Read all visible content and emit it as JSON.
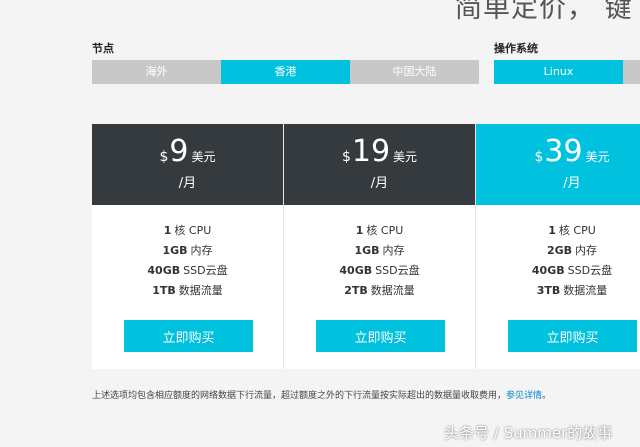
{
  "headline": "简单定价，   键",
  "node_section": {
    "label": "节点",
    "options": [
      "海外",
      "香港",
      "中国大陆"
    ],
    "selected": "香港"
  },
  "os_section": {
    "label": "操作系统",
    "options": [
      "Linux"
    ],
    "selected": "Linux"
  },
  "plans": [
    {
      "currency": "$",
      "amount": "9",
      "unit": "美元",
      "period": "/月",
      "specs": [
        {
          "value": "1",
          "label": "核 CPU"
        },
        {
          "value": "1GB",
          "label": "内存"
        },
        {
          "value": "40GB",
          "label": "SSD云盘"
        },
        {
          "value": "1TB",
          "label": "数据流量"
        }
      ],
      "buy_label": "立即购买"
    },
    {
      "currency": "$",
      "amount": "19",
      "unit": "美元",
      "period": "/月",
      "specs": [
        {
          "value": "1",
          "label": "核 CPU"
        },
        {
          "value": "1GB",
          "label": "内存"
        },
        {
          "value": "40GB",
          "label": "SSD云盘"
        },
        {
          "value": "2TB",
          "label": "数据流量"
        }
      ],
      "buy_label": "立即购买"
    },
    {
      "currency": "$",
      "amount": "39",
      "unit": "美元",
      "period": "/月",
      "specs": [
        {
          "value": "1",
          "label": "核 CPU"
        },
        {
          "value": "2GB",
          "label": "内存"
        },
        {
          "value": "40GB",
          "label": "SSD云盘"
        },
        {
          "value": "3TB",
          "label": "数据流量"
        }
      ],
      "buy_label": "立即购买"
    }
  ],
  "note": {
    "text": "上述选项均包含相应额度的网络数据下行流量，超过额度之外的下行流量按实际超出的数据量收取费用，",
    "link": "参见详情",
    "end": "。"
  },
  "watermark": "头条号 / Summer的故事",
  "colors": {
    "accent": "#00c1de",
    "dark_header": "#353a3f",
    "inactive_option": "#c8c8c8"
  }
}
